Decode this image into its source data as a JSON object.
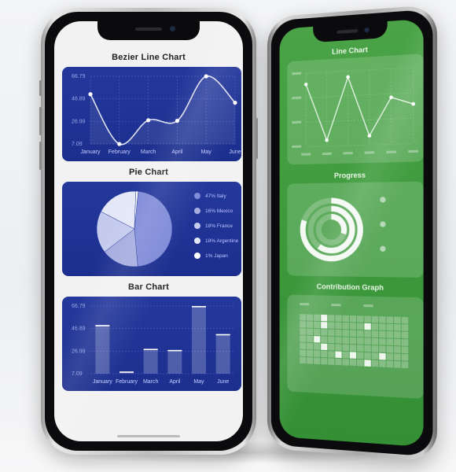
{
  "colors": {
    "card_bg": "#24389c",
    "line": "#ffffff",
    "green_bg": "#43a044"
  },
  "front_phone": {
    "bezier": {
      "title": "Bezier Line Chart",
      "chart_data": {
        "type": "line",
        "smooth": true,
        "x": [
          "January",
          "February",
          "March",
          "April",
          "May",
          "June"
        ],
        "series": [
          {
            "values": [
              51.0,
              7.09,
              28.0,
              27.5,
              66.79,
              43.5
            ]
          }
        ],
        "yticks": [
          "66.79",
          "46.89",
          "26.99",
          "7.09"
        ],
        "ylim": [
          7.09,
          66.79
        ],
        "grid": true
      }
    },
    "pie": {
      "title": "Pie Chart",
      "chart_data": {
        "type": "pie",
        "slices": [
          {
            "label": "47% Italy",
            "value": 47,
            "color": "#7f8bd8"
          },
          {
            "label": "16% Mexico",
            "value": 16,
            "color": "#a5addf"
          },
          {
            "label": "18% France",
            "value": 18,
            "color": "#c5cbed"
          },
          {
            "label": "18% Argentine",
            "value": 18,
            "color": "#e4e7f7"
          },
          {
            "label": "1% Japan",
            "value": 1,
            "color": "#ffffff"
          }
        ]
      }
    },
    "bar": {
      "title": "Bar Chart",
      "chart_data": {
        "type": "bar",
        "categories": [
          "January",
          "February",
          "March",
          "April",
          "May",
          "June"
        ],
        "values": [
          50.0,
          9.0,
          29.0,
          28.0,
          66.79,
          42.0
        ],
        "yticks": [
          "66.79",
          "46.89",
          "26.99",
          "7.09"
        ],
        "ylim": [
          7.09,
          66.79
        ],
        "grid": true
      }
    }
  },
  "back_phone": {
    "line": {
      "title": "Line Chart",
      "chart_data": {
        "type": "line",
        "x_label_count": 6,
        "y_label_count": 4,
        "series": [
          {
            "values": [
              0.85,
              0.08,
              0.92,
              0.12,
              0.62,
              0.52
            ]
          }
        ],
        "grid": true
      }
    },
    "progress": {
      "title": "Progress",
      "rings": [
        0.8,
        0.6,
        0.3
      ],
      "legend_count": 3
    },
    "contribution": {
      "title": "Contribution Graph",
      "month_label_count": 3,
      "columns": 15,
      "rows": 7,
      "highlights": [
        [
          3,
          0
        ],
        [
          3,
          1
        ],
        [
          9,
          1
        ],
        [
          3,
          4
        ],
        [
          5,
          5
        ],
        [
          7,
          5
        ],
        [
          9,
          6
        ],
        [
          11,
          5
        ],
        [
          2,
          3
        ]
      ]
    }
  }
}
